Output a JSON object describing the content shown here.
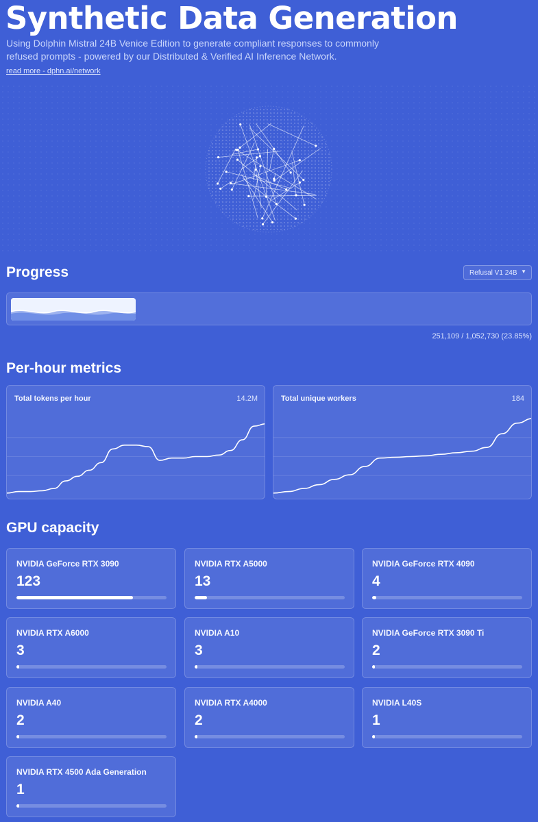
{
  "hero": {
    "title": "Synthetic Data Generation",
    "subtitle": "Using Dolphin Mistral 24B Venice Edition to generate compliant responses to commonly refused prompts - powered by our Distributed & Verified AI Inference Network.",
    "link": "read more - dphn.ai/network"
  },
  "progress": {
    "heading": "Progress",
    "model_select": "Refusal V1 24B",
    "completed": 251109,
    "total": 1052730,
    "text": "251,109 / 1,052,730 (23.85%)"
  },
  "metrics": {
    "heading": "Per-hour metrics",
    "tokens": {
      "title": "Total tokens per hour",
      "value": "14.2M"
    },
    "workers": {
      "title": "Total unique workers",
      "value": "184"
    }
  },
  "chart_data": [
    {
      "type": "line",
      "title": "Total tokens per hour",
      "latest": "14.2M",
      "values": [
        0.02,
        0.04,
        0.04,
        0.05,
        0.08,
        0.18,
        0.24,
        0.32,
        0.42,
        0.6,
        0.65,
        0.65,
        0.63,
        0.45,
        0.48,
        0.48,
        0.5,
        0.5,
        0.52,
        0.58,
        0.72,
        0.9,
        0.93
      ],
      "ylim": [
        0,
        1
      ]
    },
    {
      "type": "line",
      "title": "Total unique workers",
      "latest": "184",
      "values": [
        0.02,
        0.04,
        0.08,
        0.13,
        0.2,
        0.26,
        0.37,
        0.48,
        0.49,
        0.5,
        0.51,
        0.53,
        0.55,
        0.57,
        0.62,
        0.8,
        0.94,
        1.0
      ],
      "ylim": [
        0,
        1
      ]
    }
  ],
  "gpu": {
    "heading": "GPU capacity",
    "max_count": 158,
    "items": [
      {
        "name": "NVIDIA GeForce RTX 3090",
        "count": "123"
      },
      {
        "name": "NVIDIA RTX A5000",
        "count": "13"
      },
      {
        "name": "NVIDIA GeForce RTX 4090",
        "count": "4"
      },
      {
        "name": "NVIDIA RTX A6000",
        "count": "3"
      },
      {
        "name": "NVIDIA A10",
        "count": "3"
      },
      {
        "name": "NVIDIA GeForce RTX 3090 Ti",
        "count": "2"
      },
      {
        "name": "NVIDIA A40",
        "count": "2"
      },
      {
        "name": "NVIDIA RTX A4000",
        "count": "2"
      },
      {
        "name": "NVIDIA L40S",
        "count": "1"
      },
      {
        "name": "NVIDIA RTX 4500 Ada Generation",
        "count": "1"
      }
    ]
  },
  "colors": {
    "background": "#3f5fd6",
    "card": "#5a76de",
    "line": "#ffffff",
    "muted_text": "#c9d5fb"
  },
  "icons": {
    "select": "chevron-down-icon",
    "globe": "network-globe-graphic"
  }
}
